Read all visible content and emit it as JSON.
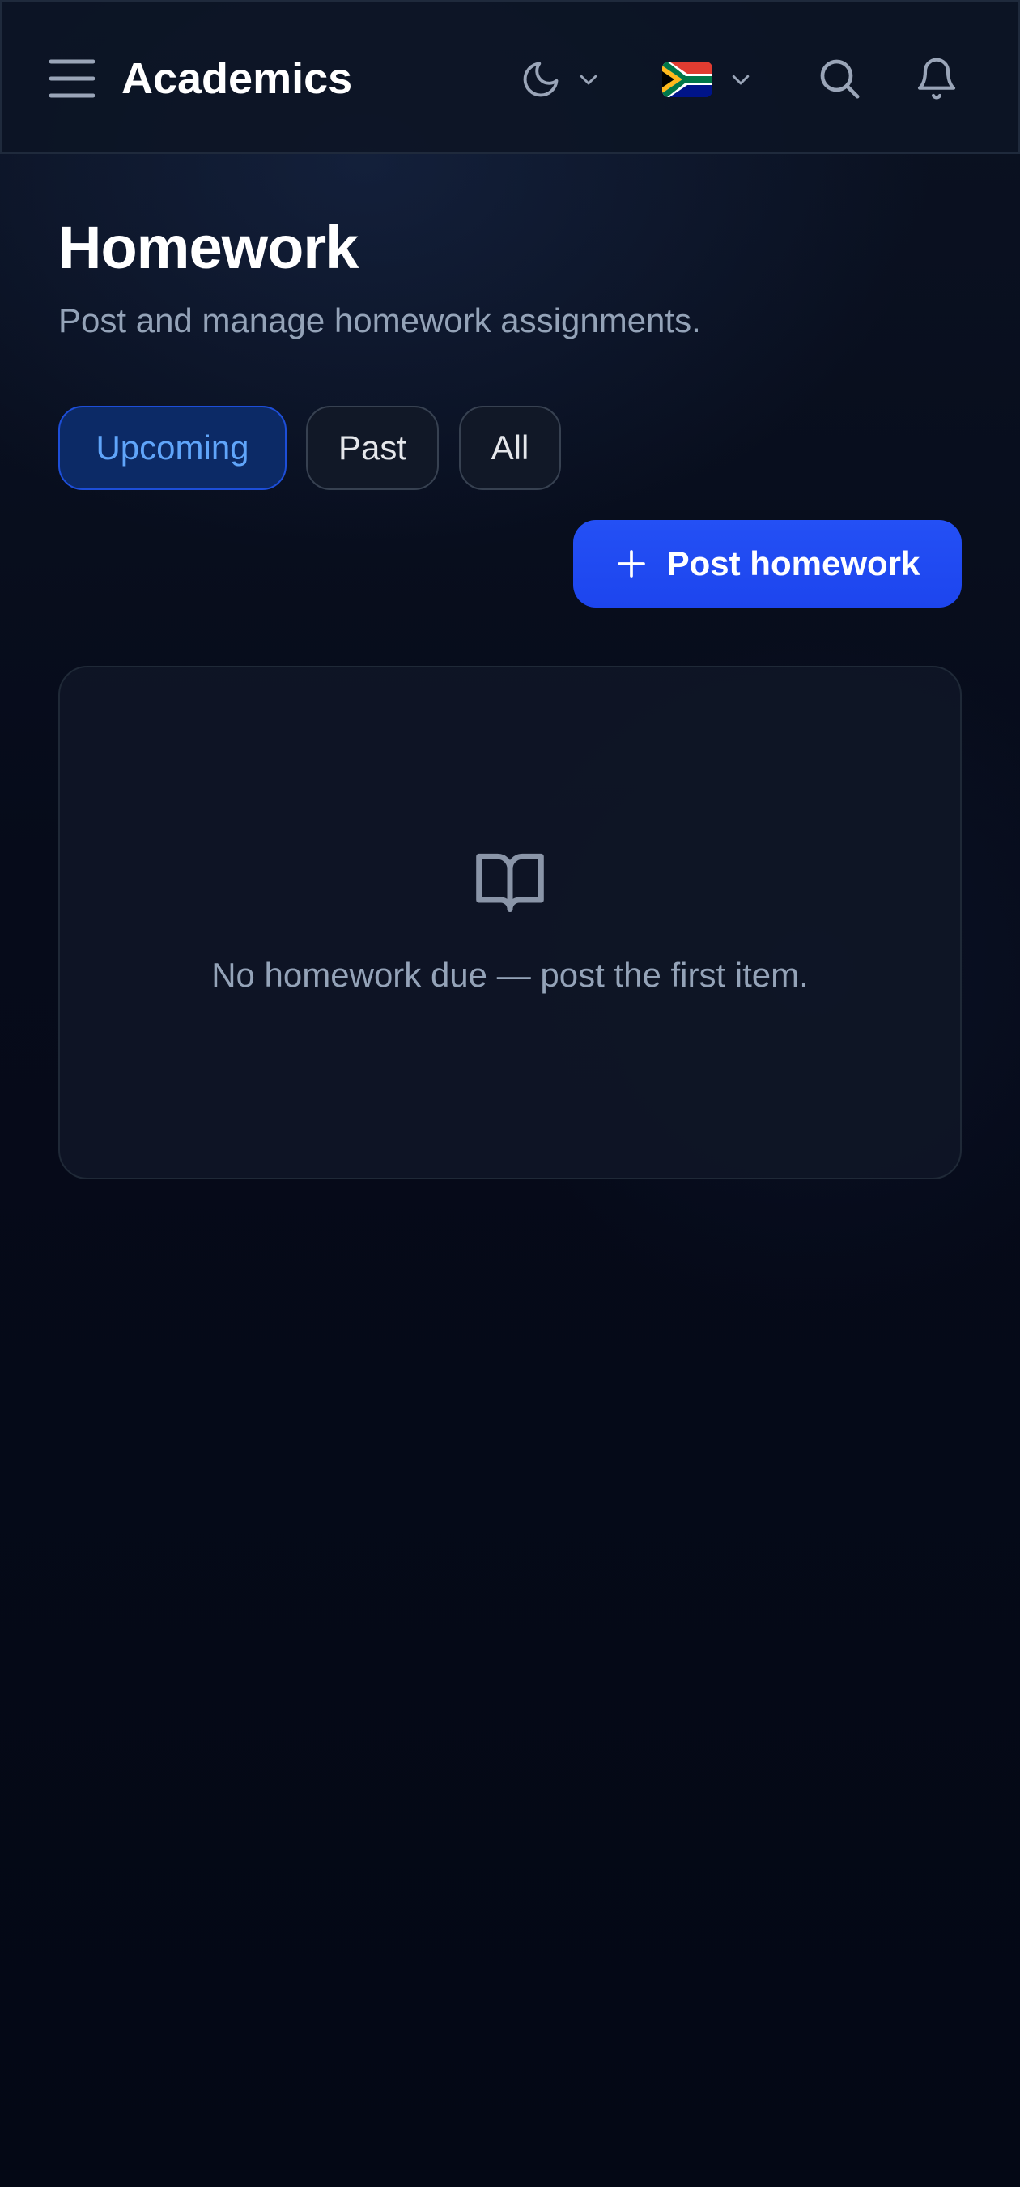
{
  "header": {
    "app_title": "Academics",
    "icons": {
      "menu": "menu-icon",
      "theme": "moon-icon",
      "language_flag": "south-africa-flag-icon",
      "dropdown": "chevron-down-icon",
      "search": "search-icon",
      "notifications": "bell-icon"
    }
  },
  "page": {
    "title": "Homework",
    "subtitle": "Post and manage homework assignments."
  },
  "tabs": [
    {
      "label": "Upcoming",
      "active": true
    },
    {
      "label": "Past",
      "active": false
    },
    {
      "label": "All",
      "active": false
    }
  ],
  "actions": {
    "post_label": "Post homework",
    "post_icon": "plus-icon"
  },
  "empty_state": {
    "icon": "book-open-icon",
    "message": "No homework due — post the first item."
  },
  "colors": {
    "background": "#060b1a",
    "primary": "#1d4ed8",
    "active_tab_text": "#60a5fa",
    "muted_text": "#94a3b8"
  }
}
